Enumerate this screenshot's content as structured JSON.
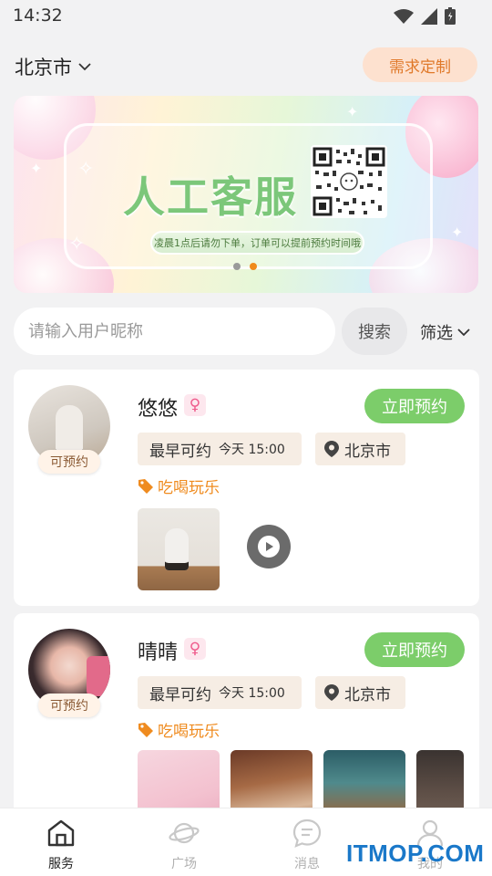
{
  "status_bar": {
    "time": "14:32"
  },
  "header": {
    "city": "北京市",
    "custom_button": "需求定制"
  },
  "banner": {
    "title": "人工客服",
    "note": "凌晨1点后请勿下单，订单可以提前预约时间哦",
    "page_count": 2,
    "active_page": 2
  },
  "search": {
    "placeholder": "请输入用户昵称",
    "value": "",
    "button": "搜索",
    "filter": "筛选"
  },
  "cards": [
    {
      "name": "悠悠",
      "gender_symbol": "♀",
      "avail_badge": "可预约",
      "book_button": "立即预约",
      "time_label": "最早可约",
      "time_value": "今天 15:00",
      "location": "北京市",
      "tag": "吃喝玩乐"
    },
    {
      "name": "晴晴",
      "gender_symbol": "♀",
      "avail_badge": "可预约",
      "book_button": "立即预约",
      "time_label": "最早可约",
      "time_value": "今天 15:00",
      "location": "北京市",
      "tag": "吃喝玩乐"
    }
  ],
  "bottom_nav": {
    "items": [
      {
        "label": "服务",
        "icon": "home-icon",
        "active": true
      },
      {
        "label": "广场",
        "icon": "planet-icon",
        "active": false
      },
      {
        "label": "消息",
        "icon": "message-icon",
        "active": false
      },
      {
        "label": "我的",
        "icon": "user-icon",
        "active": false
      }
    ]
  },
  "watermark": "ITMOP.COM",
  "colors": {
    "accent_green": "#7ccd6a",
    "accent_orange": "#ef8b1f",
    "chip_bg": "#f6ede4"
  }
}
